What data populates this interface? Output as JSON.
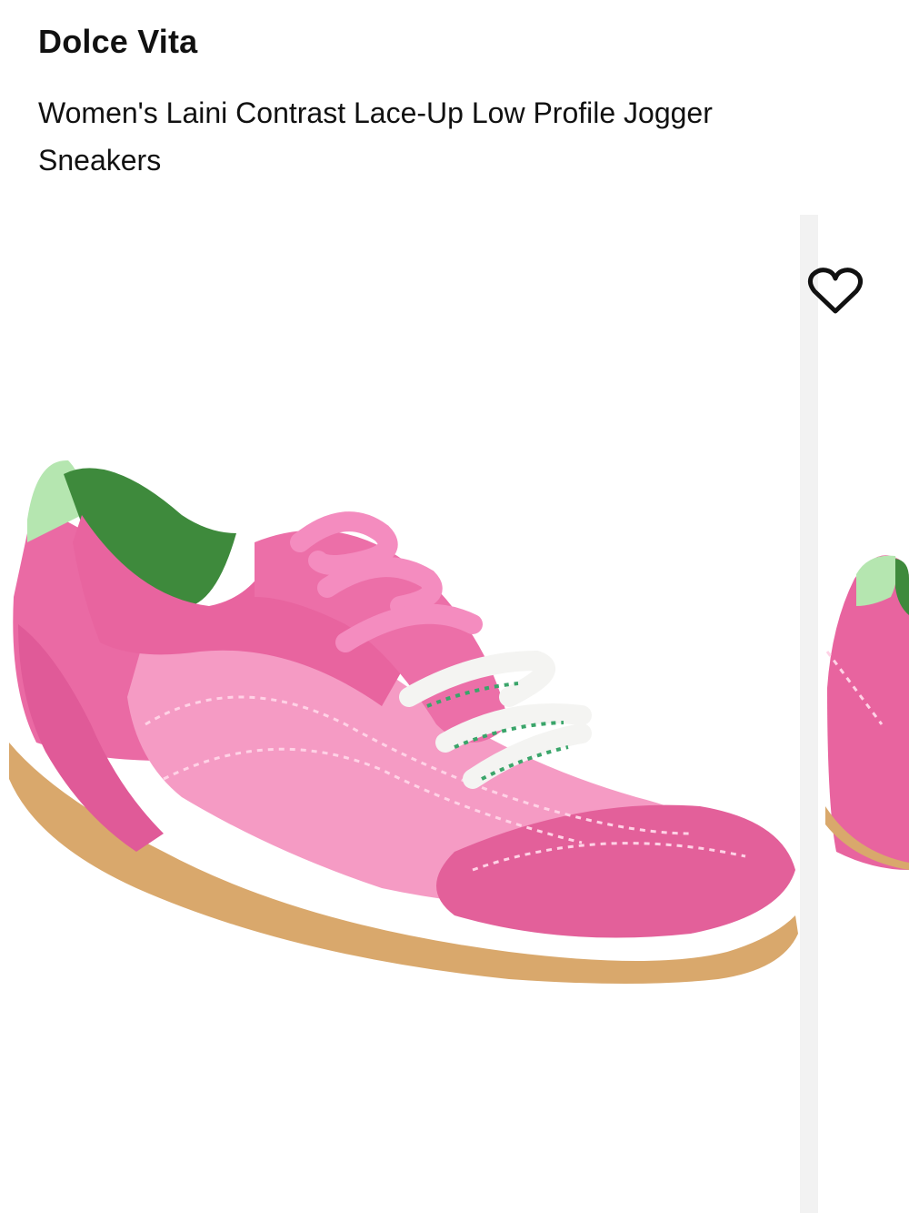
{
  "product": {
    "brand": "Dolce Vita",
    "name": "Women's Laini Contrast Lace-Up Low Profile Jogger Sneakers"
  },
  "gallery": {
    "main_image": {
      "description_icon": "pink-sneaker-image",
      "colors": {
        "upper": "#f27fb0",
        "suede": "#e3609a",
        "lining": "#3e8a3c",
        "heel_tab": "#b5e6b0",
        "sole": "#d9a86c",
        "lace_pink": "#f48cbf",
        "lace_white": "#f4f4f2",
        "lace_stripe": "#3aa56a"
      }
    },
    "wishlist_icon": "heart-outline-icon"
  }
}
